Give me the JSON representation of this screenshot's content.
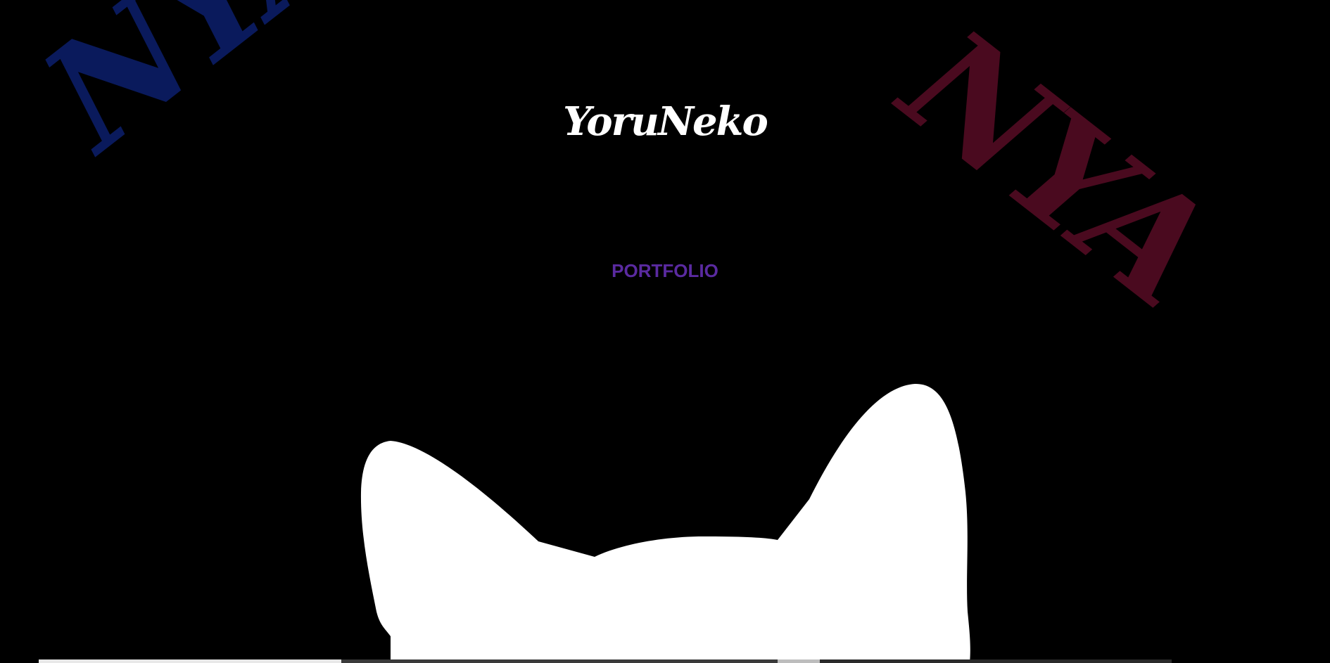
{
  "background": {
    "left_script": "NYA",
    "right_script": "NYA",
    "left_color": "#0a1a5c",
    "right_color": "#4a0a1f"
  },
  "header": {
    "logo_text": "YoruNeko"
  },
  "nav": {
    "portfolio_label": "PORTFOLIO",
    "link_color": "#5a2aa0"
  },
  "illustration": {
    "icon": "cat-silhouette-icon",
    "color": "#ffffff"
  }
}
